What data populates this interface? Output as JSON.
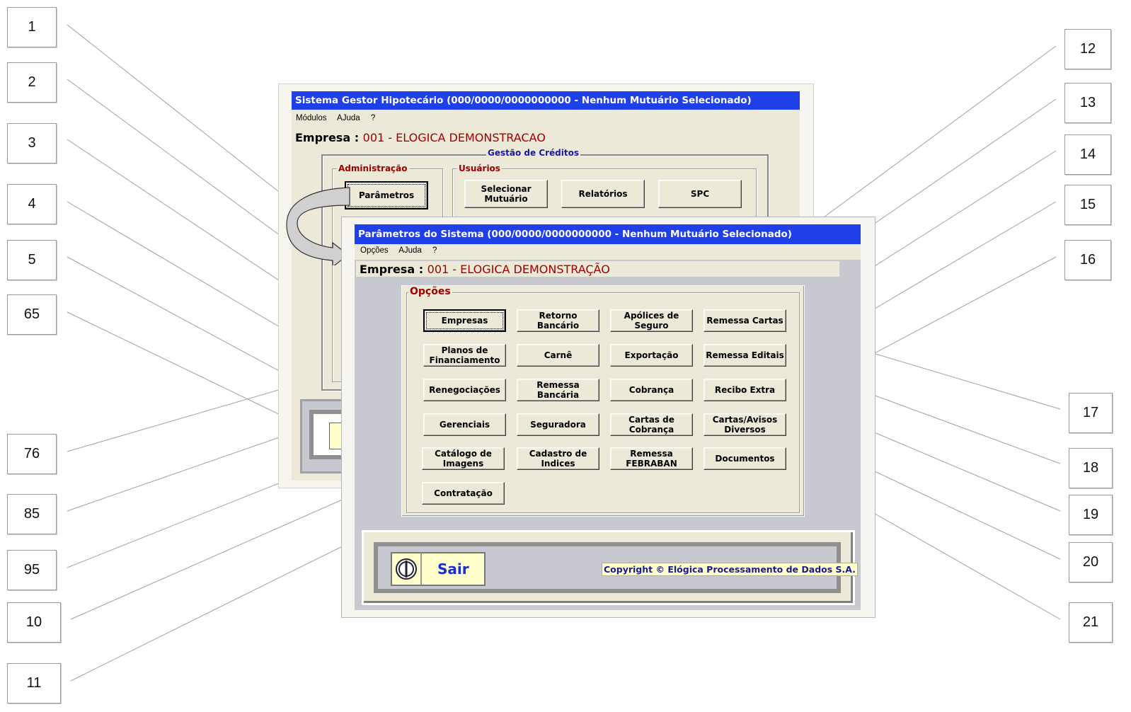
{
  "callouts": {
    "c1": "1",
    "c2": "2",
    "c3": "3",
    "c4": "4",
    "c5": "5",
    "c65": "65",
    "c76": "76",
    "c85": "85",
    "c95": "95",
    "c10": "10",
    "c11": "11",
    "c12": "12",
    "c13": "13",
    "c14": "14",
    "c15": "15",
    "c16": "16",
    "c17": "17",
    "c18": "18",
    "c19": "19",
    "c20": "20",
    "c21": "21"
  },
  "back_window": {
    "title": "Sistema Gestor Hipotecário (000/0000/0000000000 - Nenhum Mutuário Selecionado)",
    "menu": [
      "Módulos",
      "AJuda",
      "?"
    ],
    "empresa_label": "Empresa :",
    "empresa_value": "001 - ELOGICA DEMONSTRACAO",
    "group_gestao": "Gestão de Créditos",
    "group_admin": "Administração",
    "group_usuarios": "Usuários",
    "btn_parametros": "Parâmetros",
    "btn_selecionar": "Selecionar\nMutuário",
    "btn_relatorios": "Relatórios",
    "btn_spc": "SPC"
  },
  "front_window": {
    "title": "Parâmetros do Sistema (000/0000/0000000000 - Nenhum Mutuário Selecionado)",
    "menu": [
      "Opções",
      "AJuda",
      "?"
    ],
    "empresa_label": "Empresa :",
    "empresa_value": "001 - ELOGICA DEMONSTRAÇÃO",
    "group_opcoes": "Opções",
    "buttons": {
      "empresas": "Empresas",
      "retorno_bancario": "Retorno\nBancário",
      "apolices_seguro": "Apólices de\nSeguro",
      "remessa_cartas": "Remessa Cartas",
      "planos_financiamento": "Planos de\nFinanciamento",
      "carne": "Carnê",
      "exportacao": "Exportação",
      "remessa_editais": "Remessa Editais",
      "renegociacoes": "Renegociações",
      "remessa_bancaria": "Remessa\nBancária",
      "cobranca": "Cobrança",
      "recibo_extra": "Recibo Extra",
      "gerenciais": "Gerenciais",
      "seguradora": "Seguradora",
      "cartas_cobranca": "Cartas de\nCobrança",
      "cartas_avisos": "Cartas/Avisos\nDiversos",
      "catalogo_imagens": "Catálogo de\nImagens",
      "cadastro_indices": "Cadastro de\nIndices",
      "remessa_febraban": "Remessa\nFEBRABAN",
      "documentos": "Documentos",
      "contratacao": "Contratação"
    },
    "sair_label": "Sair",
    "copyright": "Copyright © Elógica Processamento de Dados S.A."
  },
  "colors": {
    "titlebar": "#1f3fe8",
    "empresa_value": "#a00000",
    "panel": "#ece9d8",
    "grey": "#c8c8d0"
  }
}
